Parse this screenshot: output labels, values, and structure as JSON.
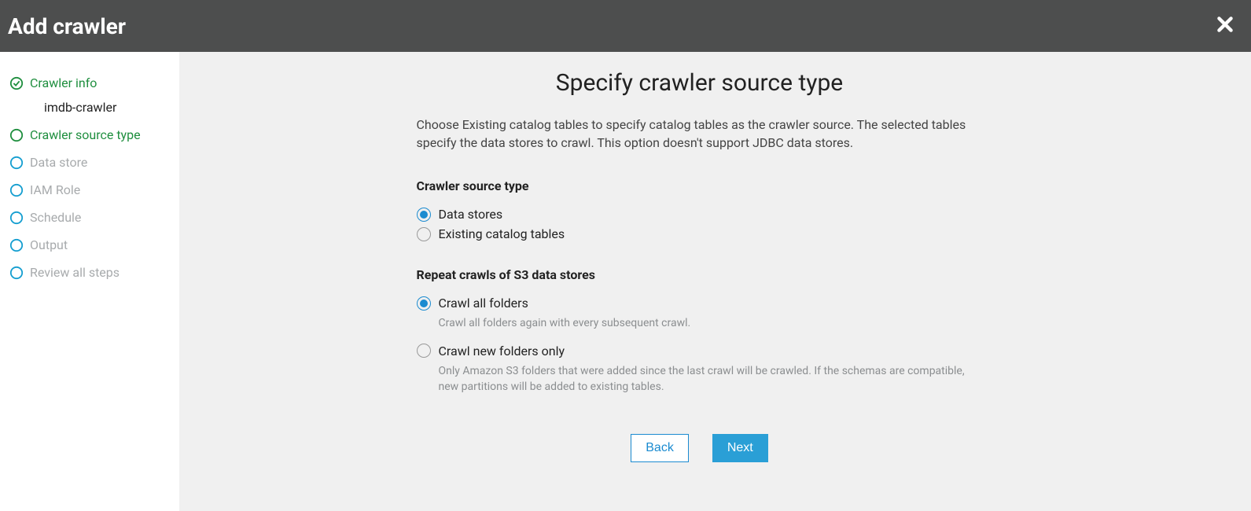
{
  "header": {
    "title": "Add crawler"
  },
  "sidebar": {
    "steps": [
      {
        "label": "Crawler info",
        "state": "completed",
        "sub": "imdb-crawler"
      },
      {
        "label": "Crawler source type",
        "state": "current"
      },
      {
        "label": "Data store",
        "state": "pending"
      },
      {
        "label": "IAM Role",
        "state": "pending"
      },
      {
        "label": "Schedule",
        "state": "pending"
      },
      {
        "label": "Output",
        "state": "pending"
      },
      {
        "label": "Review all steps",
        "state": "pending"
      }
    ]
  },
  "main": {
    "title": "Specify crawler source type",
    "description": "Choose Existing catalog tables to specify catalog tables as the crawler source. The selected tables specify the data stores to crawl. This option doesn't support JDBC data stores.",
    "section_source": {
      "title": "Crawler source type",
      "options": [
        {
          "label": "Data stores",
          "selected": true
        },
        {
          "label": "Existing catalog tables",
          "selected": false
        }
      ]
    },
    "section_repeat": {
      "title": "Repeat crawls of S3 data stores",
      "options": [
        {
          "label": "Crawl all folders",
          "selected": true,
          "desc": "Crawl all folders again with every subsequent crawl."
        },
        {
          "label": "Crawl new folders only",
          "selected": false,
          "desc": "Only Amazon S3 folders that were added since the last crawl will be crawled. If the schemas are compatible, new partitions will be added to existing tables."
        }
      ]
    },
    "buttons": {
      "back": "Back",
      "next": "Next"
    }
  }
}
